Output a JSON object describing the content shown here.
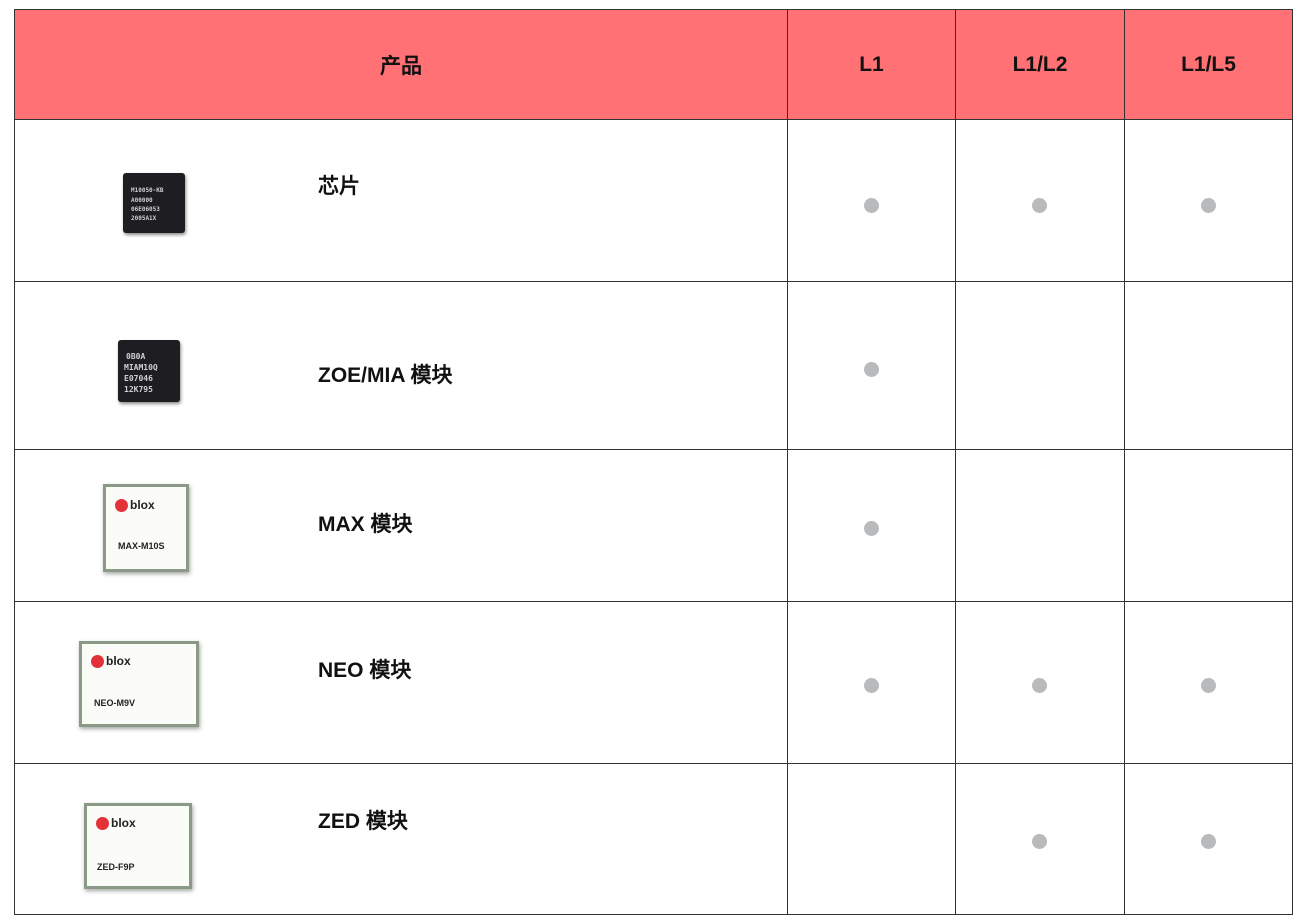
{
  "header": {
    "product": "产品",
    "l1": "L1",
    "l1l2": "L1/L2",
    "l1l5": "L1/L5"
  },
  "rows": [
    {
      "name": "芯片",
      "image": "chip",
      "chip_text": [
        "M10050-KB",
        "A00000",
        "06E06053",
        "2005A1X"
      ],
      "l1": true,
      "l1l2": true,
      "l1l5": true
    },
    {
      "name": "ZOE/MIA 模块",
      "image": "chip",
      "chip_text": [
        "0B0A",
        "MIAM10Q",
        "E07046",
        "12K795"
      ],
      "l1": true,
      "l1l2": false,
      "l1l5": false
    },
    {
      "name": "MAX 模块",
      "image": "module",
      "brand": "blox",
      "part": "MAX-M10S",
      "l1": true,
      "l1l2": false,
      "l1l5": false
    },
    {
      "name": "NEO 模块",
      "image": "module",
      "brand": "blox",
      "part": "NEO-M9V",
      "l1": true,
      "l1l2": true,
      "l1l5": true
    },
    {
      "name": "ZED 模块",
      "image": "module",
      "brand": "blox",
      "part": "ZED-F9P",
      "l1": false,
      "l1l2": true,
      "l1l5": true
    }
  ],
  "colors": {
    "header_bg": "#ff7174",
    "dot": "#b9babc",
    "logo": "#e3313a"
  }
}
